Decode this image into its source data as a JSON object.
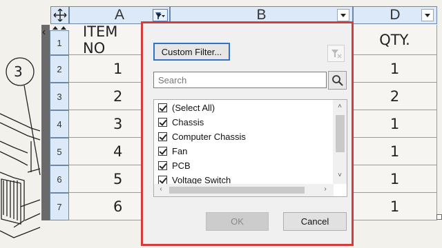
{
  "columns": [
    {
      "letter": "A"
    },
    {
      "letter": "B"
    },
    {
      "letter": "D"
    }
  ],
  "rows": [
    {
      "num": "1",
      "item": "ITEM NO",
      "qty": "QTY."
    },
    {
      "num": "2",
      "item": "1",
      "qty": "1"
    },
    {
      "num": "3",
      "item": "2",
      "qty": "2"
    },
    {
      "num": "4",
      "item": "3",
      "qty": "1"
    },
    {
      "num": "5",
      "item": "4",
      "qty": "1"
    },
    {
      "num": "6",
      "item": "5",
      "qty": "1"
    },
    {
      "num": "7",
      "item": "6",
      "qty": "1"
    }
  ],
  "balloon": {
    "label": "3"
  },
  "filter_popup": {
    "custom_filter_label": "Custom Filter...",
    "search_placeholder": "Search",
    "items": [
      {
        "label": "(Select All)",
        "checked": true
      },
      {
        "label": "Chassis",
        "checked": true
      },
      {
        "label": "Computer Chassis",
        "checked": true
      },
      {
        "label": "Fan",
        "checked": true
      },
      {
        "label": "PCB",
        "checked": true
      },
      {
        "label": "Voltage Switch",
        "checked": true
      }
    ],
    "ok_label": "OK",
    "cancel_label": "Cancel",
    "border_color": "#d63b3b",
    "accent_color": "#2f73c8"
  }
}
